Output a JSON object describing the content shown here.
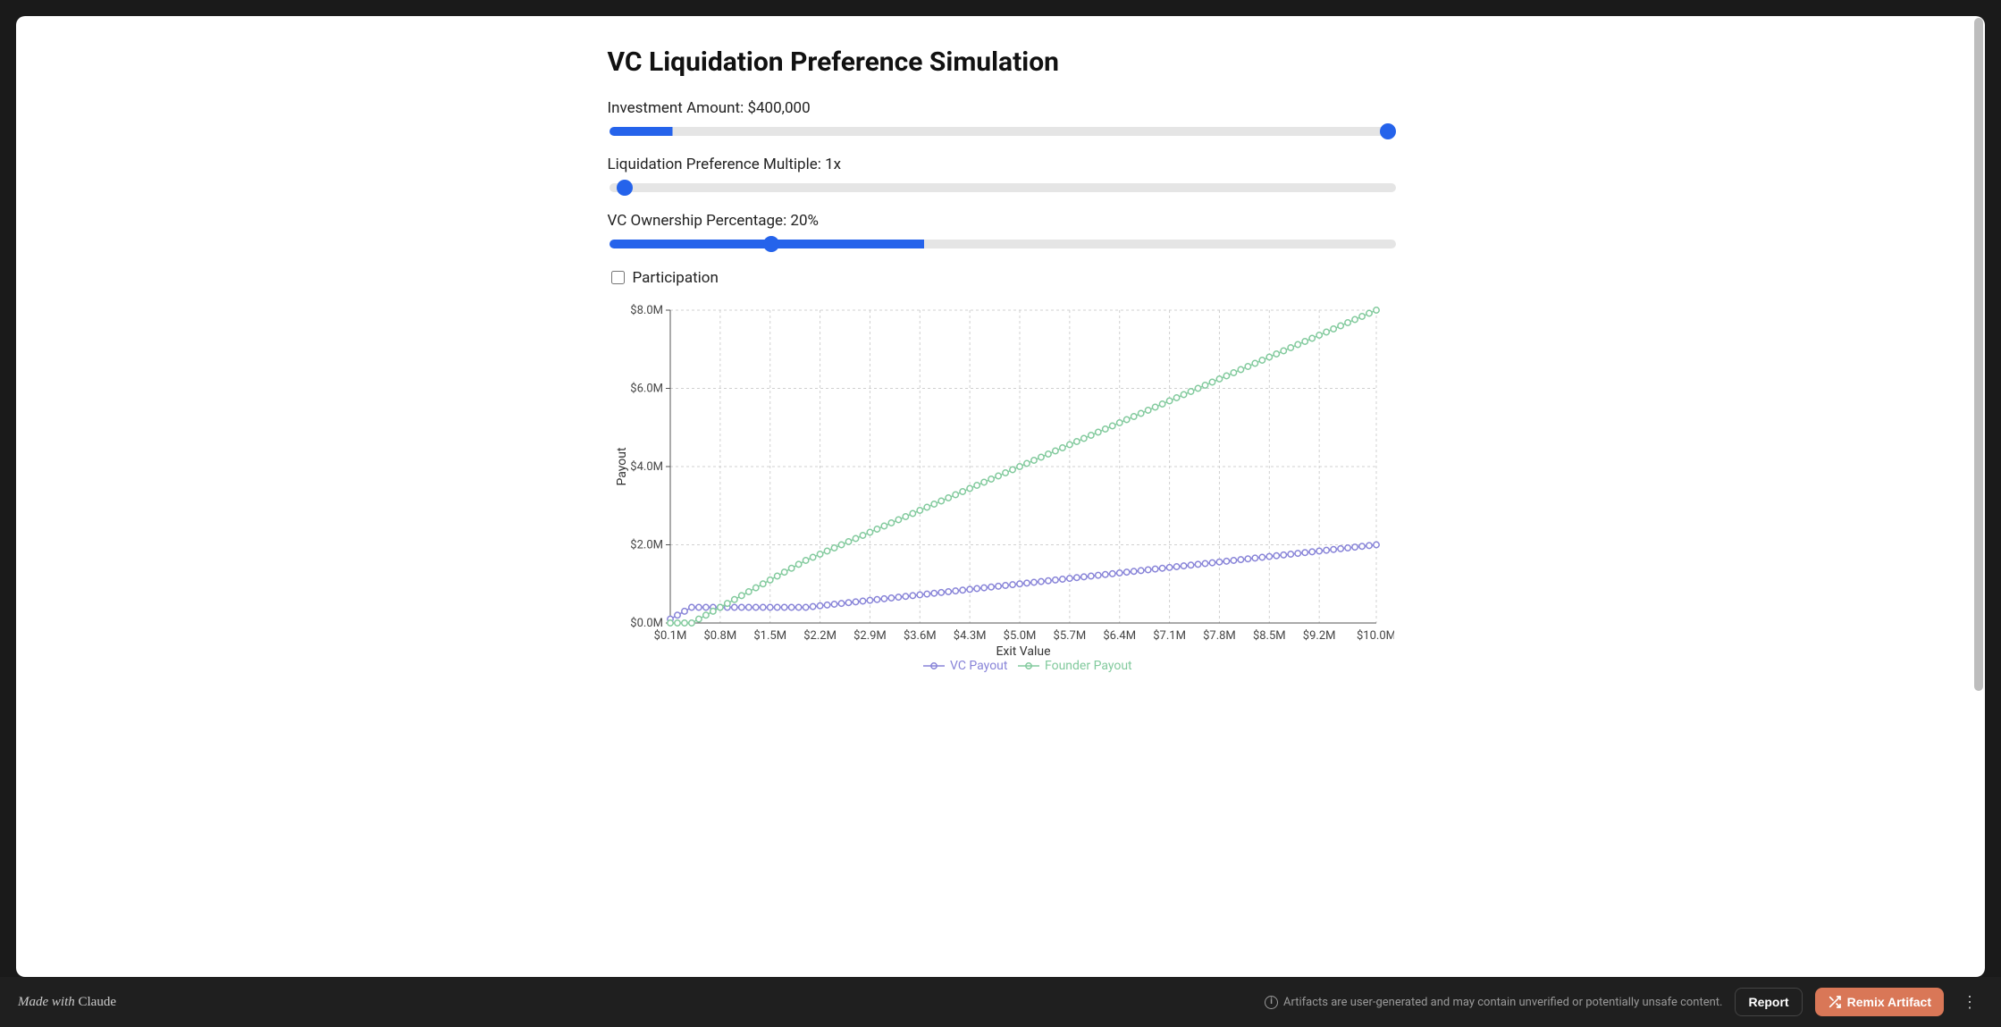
{
  "page": {
    "title": "VC Liquidation Preference Simulation"
  },
  "controls": {
    "investment": {
      "label_prefix": "Investment Amount: ",
      "value_display": "$400,000",
      "value": 400000,
      "min": 0,
      "max": 5000000,
      "percent": 8
    },
    "multiple": {
      "label_prefix": "Liquidation Preference Multiple: ",
      "value_display": "1x",
      "value": 1,
      "min": 1,
      "max": 5,
      "percent": 0
    },
    "ownership": {
      "label_prefix": "VC Ownership Percentage: ",
      "value_display": "20%",
      "value": 20,
      "min": 0,
      "max": 50,
      "percent": 40
    },
    "participation": {
      "label": "Participation",
      "checked": false
    }
  },
  "chart_data": {
    "type": "line",
    "title": "",
    "xlabel": "Exit Value",
    "ylabel": "Payout",
    "xlim": [
      0.1,
      10.0
    ],
    "ylim": [
      0.0,
      8.0
    ],
    "x_ticks": [
      "$0.1M",
      "$0.8M",
      "$1.5M",
      "$2.2M",
      "$2.9M",
      "$3.6M",
      "$4.3M",
      "$5.0M",
      "$5.7M",
      "$6.4M",
      "$7.1M",
      "$7.8M",
      "$8.5M",
      "$9.2M",
      "$10.0M"
    ],
    "y_ticks": [
      "$0.0M",
      "$2.0M",
      "$4.0M",
      "$6.0M",
      "$8.0M"
    ],
    "x": [
      0.1,
      0.2,
      0.3,
      0.4,
      0.5,
      0.6,
      0.7,
      0.8,
      0.9,
      1.0,
      1.1,
      1.2,
      1.3,
      1.4,
      1.5,
      1.6,
      1.7,
      1.8,
      1.9,
      2.0,
      2.1,
      2.2,
      2.3,
      2.4,
      2.5,
      2.6,
      2.7,
      2.8,
      2.9,
      3.0,
      3.1,
      3.2,
      3.3,
      3.4,
      3.5,
      3.6,
      3.7,
      3.8,
      3.9,
      4.0,
      4.1,
      4.2,
      4.3,
      4.4,
      4.5,
      4.6,
      4.7,
      4.8,
      4.9,
      5.0,
      5.1,
      5.2,
      5.3,
      5.4,
      5.5,
      5.6,
      5.7,
      5.8,
      5.9,
      6.0,
      6.1,
      6.2,
      6.3,
      6.4,
      6.5,
      6.6,
      6.7,
      6.8,
      6.9,
      7.0,
      7.1,
      7.2,
      7.3,
      7.4,
      7.5,
      7.6,
      7.7,
      7.8,
      7.9,
      8.0,
      8.1,
      8.2,
      8.3,
      8.4,
      8.5,
      8.6,
      8.7,
      8.8,
      8.9,
      9.0,
      9.1,
      9.2,
      9.3,
      9.4,
      9.5,
      9.6,
      9.7,
      9.8,
      9.9,
      10.0
    ],
    "series": [
      {
        "name": "VC Payout",
        "color": "#8884d8",
        "values": [
          0.1,
          0.2,
          0.3,
          0.4,
          0.4,
          0.4,
          0.4,
          0.4,
          0.4,
          0.4,
          0.4,
          0.4,
          0.4,
          0.4,
          0.4,
          0.4,
          0.4,
          0.4,
          0.4,
          0.4,
          0.42,
          0.44,
          0.46,
          0.48,
          0.5,
          0.52,
          0.54,
          0.56,
          0.58,
          0.6,
          0.62,
          0.64,
          0.66,
          0.68,
          0.7,
          0.72,
          0.74,
          0.76,
          0.78,
          0.8,
          0.82,
          0.84,
          0.86,
          0.88,
          0.9,
          0.92,
          0.94,
          0.96,
          0.98,
          1.0,
          1.02,
          1.04,
          1.06,
          1.08,
          1.1,
          1.12,
          1.14,
          1.16,
          1.18,
          1.2,
          1.22,
          1.24,
          1.26,
          1.28,
          1.3,
          1.32,
          1.34,
          1.36,
          1.38,
          1.4,
          1.42,
          1.44,
          1.46,
          1.48,
          1.5,
          1.52,
          1.54,
          1.56,
          1.58,
          1.6,
          1.62,
          1.64,
          1.66,
          1.68,
          1.7,
          1.72,
          1.74,
          1.76,
          1.78,
          1.8,
          1.82,
          1.84,
          1.86,
          1.88,
          1.9,
          1.92,
          1.94,
          1.96,
          1.98,
          2.0
        ]
      },
      {
        "name": "Founder Payout",
        "color": "#82ca9d",
        "values": [
          0.0,
          0.0,
          0.0,
          0.0,
          0.1,
          0.2,
          0.3,
          0.4,
          0.5,
          0.6,
          0.7,
          0.8,
          0.9,
          1.0,
          1.1,
          1.2,
          1.3,
          1.4,
          1.5,
          1.6,
          1.68,
          1.76,
          1.84,
          1.92,
          2.0,
          2.08,
          2.16,
          2.24,
          2.32,
          2.4,
          2.48,
          2.56,
          2.64,
          2.72,
          2.8,
          2.88,
          2.96,
          3.04,
          3.12,
          3.2,
          3.28,
          3.36,
          3.44,
          3.52,
          3.6,
          3.68,
          3.76,
          3.84,
          3.92,
          4.0,
          4.08,
          4.16,
          4.24,
          4.32,
          4.4,
          4.48,
          4.56,
          4.64,
          4.72,
          4.8,
          4.88,
          4.96,
          5.04,
          5.12,
          5.2,
          5.28,
          5.36,
          5.44,
          5.52,
          5.6,
          5.68,
          5.76,
          5.84,
          5.92,
          6.0,
          6.08,
          6.16,
          6.24,
          6.32,
          6.4,
          6.48,
          6.56,
          6.64,
          6.72,
          6.8,
          6.88,
          6.96,
          7.04,
          7.12,
          7.2,
          7.28,
          7.36,
          7.44,
          7.52,
          7.6,
          7.68,
          7.76,
          7.84,
          7.92,
          8.0
        ]
      }
    ],
    "legend": [
      "VC Payout",
      "Founder Payout"
    ]
  },
  "footer": {
    "made_with_prefix": "Made with ",
    "made_with_brand": "Claude",
    "disclaimer": "Artifacts are user-generated and may contain unverified or potentially unsafe content.",
    "report": "Report",
    "remix": "Remix Artifact"
  }
}
